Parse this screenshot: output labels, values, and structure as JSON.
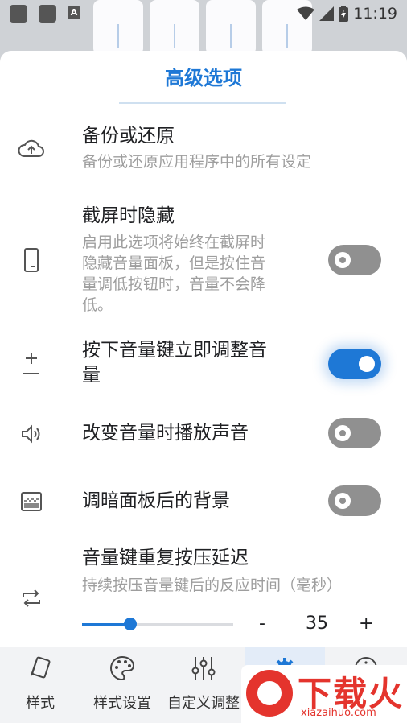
{
  "status_bar": {
    "time": "11:19",
    "a_icon": "A"
  },
  "sheet": {
    "title": "高级选项"
  },
  "rows": [
    {
      "title": "备份或还原",
      "subtitle": "备份或还原应用程序中的所有设定",
      "icon": "cloud-upload-icon"
    },
    {
      "title": "截屏时隐藏",
      "subtitle_lines": [
        "启用此选项将始终在截屏时",
        "隐藏音量面板，但是按住音",
        "量调低按钮时，音量不会降",
        "低。"
      ],
      "icon": "phone-outline-icon",
      "toggle": false
    },
    {
      "title_lines": [
        "按下音量键立即调整音",
        "量"
      ],
      "icon": "plus-minus-icon",
      "toggle": true
    },
    {
      "title": "改变音量时播放声音",
      "icon": "speaker-icon",
      "toggle": false
    },
    {
      "title": "调暗面板后的背景",
      "icon": "dim-background-icon",
      "toggle": false
    },
    {
      "title": "音量键重复按压延迟",
      "subtitle": "持续按压音量键后的反应时间（毫秒）",
      "icon": "repeat-icon",
      "slider": {
        "fraction": 0.32,
        "minus": "-",
        "value": "35",
        "plus": "+"
      }
    }
  ],
  "bottom_nav": [
    {
      "label": "样式",
      "icon": "style-cards-icon"
    },
    {
      "label": "样式设置",
      "icon": "palette-icon"
    },
    {
      "label": "自定义调整",
      "icon": "sliders-icon"
    },
    {
      "label": "",
      "icon": "gear-icon",
      "active": true
    },
    {
      "label": "",
      "icon": "info-icon"
    }
  ],
  "watermark": {
    "text": "下载火",
    "url": "xiazaihuo.com"
  },
  "colors": {
    "accent": "#1e78d6",
    "toggle_off": "#909090",
    "watermark": "#e4342d"
  }
}
